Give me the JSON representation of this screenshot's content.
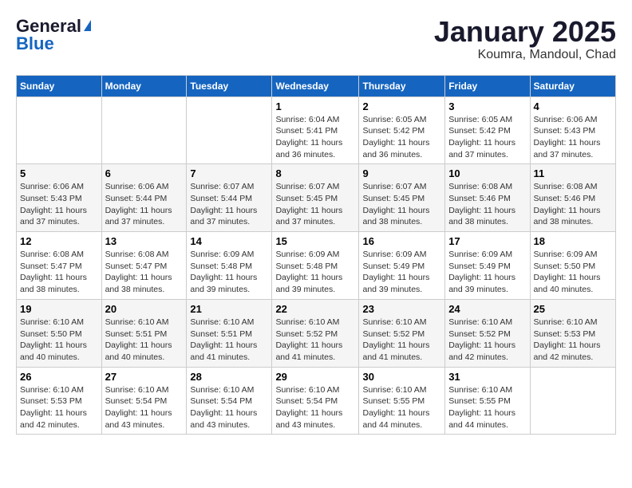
{
  "logo": {
    "general": "General",
    "blue": "Blue"
  },
  "title": "January 2025",
  "subtitle": "Koumra, Mandoul, Chad",
  "days_of_week": [
    "Sunday",
    "Monday",
    "Tuesday",
    "Wednesday",
    "Thursday",
    "Friday",
    "Saturday"
  ],
  "weeks": [
    [
      {
        "date": "",
        "info": ""
      },
      {
        "date": "",
        "info": ""
      },
      {
        "date": "",
        "info": ""
      },
      {
        "date": "1",
        "info": "Sunrise: 6:04 AM\nSunset: 5:41 PM\nDaylight: 11 hours and 36 minutes."
      },
      {
        "date": "2",
        "info": "Sunrise: 6:05 AM\nSunset: 5:42 PM\nDaylight: 11 hours and 36 minutes."
      },
      {
        "date": "3",
        "info": "Sunrise: 6:05 AM\nSunset: 5:42 PM\nDaylight: 11 hours and 37 minutes."
      },
      {
        "date": "4",
        "info": "Sunrise: 6:06 AM\nSunset: 5:43 PM\nDaylight: 11 hours and 37 minutes."
      }
    ],
    [
      {
        "date": "5",
        "info": "Sunrise: 6:06 AM\nSunset: 5:43 PM\nDaylight: 11 hours and 37 minutes."
      },
      {
        "date": "6",
        "info": "Sunrise: 6:06 AM\nSunset: 5:44 PM\nDaylight: 11 hours and 37 minutes."
      },
      {
        "date": "7",
        "info": "Sunrise: 6:07 AM\nSunset: 5:44 PM\nDaylight: 11 hours and 37 minutes."
      },
      {
        "date": "8",
        "info": "Sunrise: 6:07 AM\nSunset: 5:45 PM\nDaylight: 11 hours and 37 minutes."
      },
      {
        "date": "9",
        "info": "Sunrise: 6:07 AM\nSunset: 5:45 PM\nDaylight: 11 hours and 38 minutes."
      },
      {
        "date": "10",
        "info": "Sunrise: 6:08 AM\nSunset: 5:46 PM\nDaylight: 11 hours and 38 minutes."
      },
      {
        "date": "11",
        "info": "Sunrise: 6:08 AM\nSunset: 5:46 PM\nDaylight: 11 hours and 38 minutes."
      }
    ],
    [
      {
        "date": "12",
        "info": "Sunrise: 6:08 AM\nSunset: 5:47 PM\nDaylight: 11 hours and 38 minutes."
      },
      {
        "date": "13",
        "info": "Sunrise: 6:08 AM\nSunset: 5:47 PM\nDaylight: 11 hours and 38 minutes."
      },
      {
        "date": "14",
        "info": "Sunrise: 6:09 AM\nSunset: 5:48 PM\nDaylight: 11 hours and 39 minutes."
      },
      {
        "date": "15",
        "info": "Sunrise: 6:09 AM\nSunset: 5:48 PM\nDaylight: 11 hours and 39 minutes."
      },
      {
        "date": "16",
        "info": "Sunrise: 6:09 AM\nSunset: 5:49 PM\nDaylight: 11 hours and 39 minutes."
      },
      {
        "date": "17",
        "info": "Sunrise: 6:09 AM\nSunset: 5:49 PM\nDaylight: 11 hours and 39 minutes."
      },
      {
        "date": "18",
        "info": "Sunrise: 6:09 AM\nSunset: 5:50 PM\nDaylight: 11 hours and 40 minutes."
      }
    ],
    [
      {
        "date": "19",
        "info": "Sunrise: 6:10 AM\nSunset: 5:50 PM\nDaylight: 11 hours and 40 minutes."
      },
      {
        "date": "20",
        "info": "Sunrise: 6:10 AM\nSunset: 5:51 PM\nDaylight: 11 hours and 40 minutes."
      },
      {
        "date": "21",
        "info": "Sunrise: 6:10 AM\nSunset: 5:51 PM\nDaylight: 11 hours and 41 minutes."
      },
      {
        "date": "22",
        "info": "Sunrise: 6:10 AM\nSunset: 5:52 PM\nDaylight: 11 hours and 41 minutes."
      },
      {
        "date": "23",
        "info": "Sunrise: 6:10 AM\nSunset: 5:52 PM\nDaylight: 11 hours and 41 minutes."
      },
      {
        "date": "24",
        "info": "Sunrise: 6:10 AM\nSunset: 5:52 PM\nDaylight: 11 hours and 42 minutes."
      },
      {
        "date": "25",
        "info": "Sunrise: 6:10 AM\nSunset: 5:53 PM\nDaylight: 11 hours and 42 minutes."
      }
    ],
    [
      {
        "date": "26",
        "info": "Sunrise: 6:10 AM\nSunset: 5:53 PM\nDaylight: 11 hours and 42 minutes."
      },
      {
        "date": "27",
        "info": "Sunrise: 6:10 AM\nSunset: 5:54 PM\nDaylight: 11 hours and 43 minutes."
      },
      {
        "date": "28",
        "info": "Sunrise: 6:10 AM\nSunset: 5:54 PM\nDaylight: 11 hours and 43 minutes."
      },
      {
        "date": "29",
        "info": "Sunrise: 6:10 AM\nSunset: 5:54 PM\nDaylight: 11 hours and 43 minutes."
      },
      {
        "date": "30",
        "info": "Sunrise: 6:10 AM\nSunset: 5:55 PM\nDaylight: 11 hours and 44 minutes."
      },
      {
        "date": "31",
        "info": "Sunrise: 6:10 AM\nSunset: 5:55 PM\nDaylight: 11 hours and 44 minutes."
      },
      {
        "date": "",
        "info": ""
      }
    ]
  ]
}
